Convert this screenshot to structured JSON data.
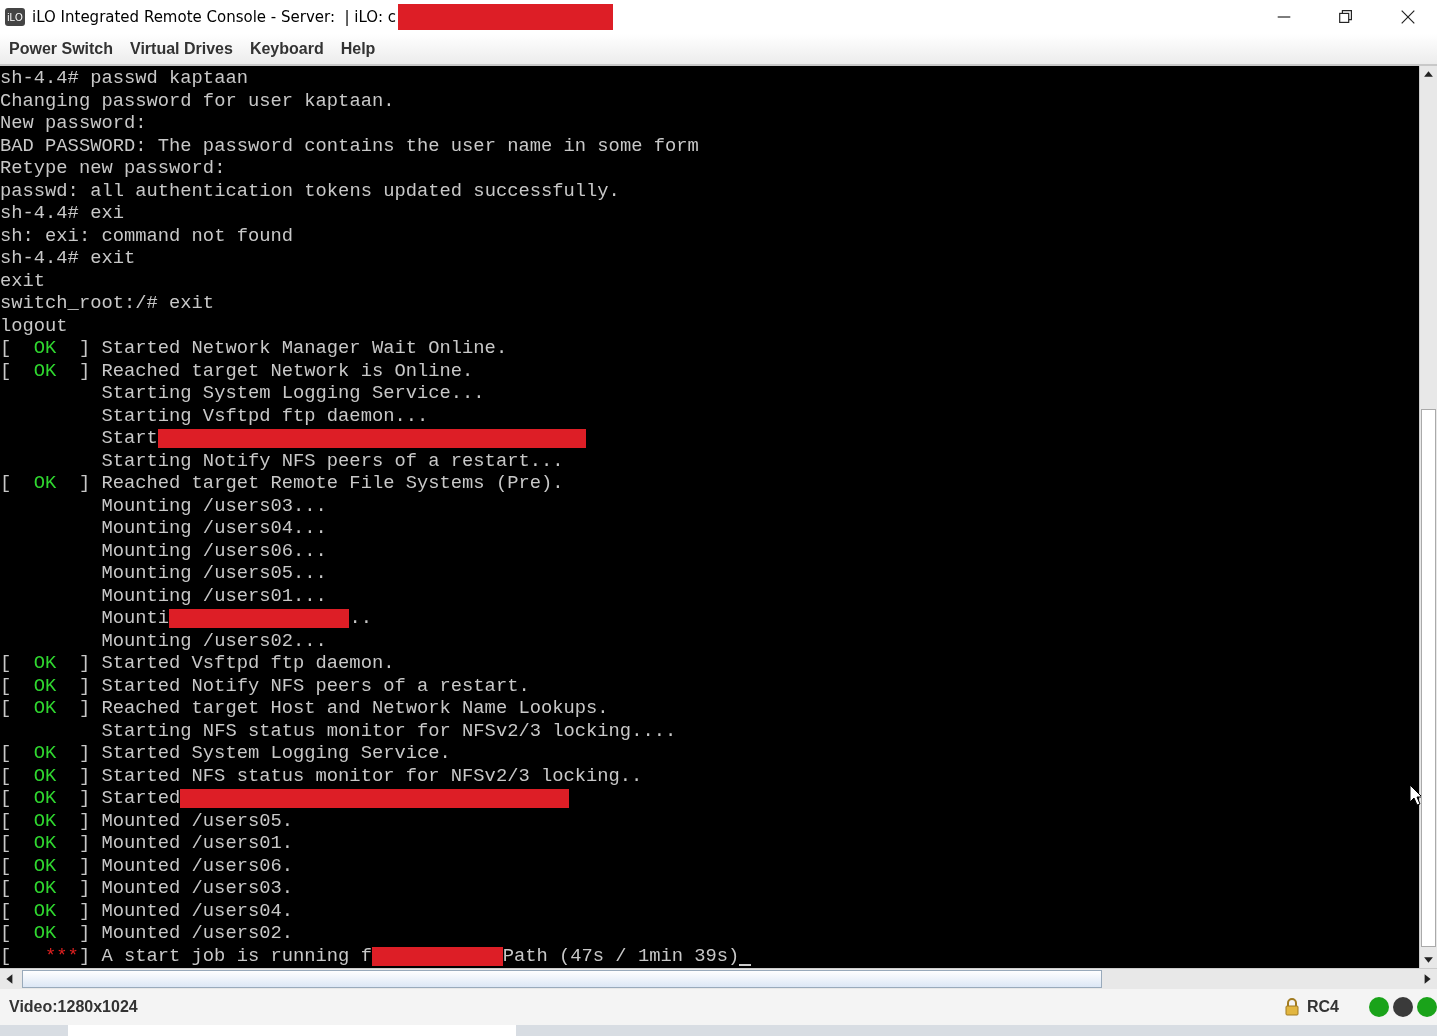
{
  "window": {
    "app_icon": "iLO",
    "title": "iLO Integrated Remote Console - Server:  | iLO: c",
    "title_redacted": true
  },
  "menu": [
    "Power Switch",
    "Virtual Drives",
    "Keyboard",
    "Help"
  ],
  "console": {
    "lines": [
      {
        "kind": "plain",
        "text": "sh-4.4# passwd kaptaan"
      },
      {
        "kind": "plain",
        "text": "Changing password for user kaptaan."
      },
      {
        "kind": "plain",
        "text": "New password:"
      },
      {
        "kind": "plain",
        "text": "BAD PASSWORD: The password contains the user name in some form"
      },
      {
        "kind": "plain",
        "text": "Retype new password:"
      },
      {
        "kind": "plain",
        "text": "passwd: all authentication tokens updated successfully."
      },
      {
        "kind": "plain",
        "text": "sh-4.4# exi"
      },
      {
        "kind": "plain",
        "text": "sh: exi: command not found"
      },
      {
        "kind": "plain",
        "text": "sh-4.4# exit"
      },
      {
        "kind": "plain",
        "text": "exit"
      },
      {
        "kind": "plain",
        "text": "switch_root:/# exit"
      },
      {
        "kind": "plain",
        "text": "logout"
      },
      {
        "kind": "ok",
        "open": "[",
        "status": "OK",
        "close": "]",
        "text": "Started Network Manager Wait Online."
      },
      {
        "kind": "ok",
        "open": "[",
        "status": "OK",
        "close": "]",
        "text": "Reached target Network is Online."
      },
      {
        "kind": "indent",
        "text": "Starting System Logging Service..."
      },
      {
        "kind": "indent",
        "text": "Starting Vsftpd ftp daemon..."
      },
      {
        "kind": "indent",
        "text": "Start",
        "redacted": true
      },
      {
        "kind": "indent",
        "text": "Starting Notify NFS peers of a restart..."
      },
      {
        "kind": "ok",
        "open": "[",
        "status": "OK",
        "close": "]",
        "text": "Reached target Remote File Systems (Pre)."
      },
      {
        "kind": "indent",
        "text": "Mounting /users03..."
      },
      {
        "kind": "indent",
        "text": "Mounting /users04..."
      },
      {
        "kind": "indent",
        "text": "Mounting /users06..."
      },
      {
        "kind": "indent",
        "text": "Mounting /users05..."
      },
      {
        "kind": "indent",
        "text": "Mounting /users01..."
      },
      {
        "kind": "indent",
        "text": "Mounti",
        "redacted": true,
        "after": ".."
      },
      {
        "kind": "indent",
        "text": "Mounting /users02..."
      },
      {
        "kind": "ok",
        "open": "[",
        "status": "OK",
        "close": "]",
        "text": "Started Vsftpd ftp daemon."
      },
      {
        "kind": "ok",
        "open": "[",
        "status": "OK",
        "close": "]",
        "text": "Started Notify NFS peers of a restart."
      },
      {
        "kind": "ok",
        "open": "[",
        "status": "OK",
        "close": "]",
        "text": "Reached target Host and Network Name Lookups."
      },
      {
        "kind": "indent",
        "text": "Starting NFS status monitor for NFSv2/3 locking...."
      },
      {
        "kind": "ok",
        "open": "[",
        "status": "OK",
        "close": "]",
        "text": "Started System Logging Service."
      },
      {
        "kind": "ok",
        "open": "[",
        "status": "OK",
        "close": "]",
        "text": "Started NFS status monitor for NFSv2/3 locking.."
      },
      {
        "kind": "ok",
        "open": "[",
        "status": "OK",
        "close": "]",
        "text": "Started",
        "redacted": true
      },
      {
        "kind": "ok",
        "open": "[",
        "status": "OK",
        "close": "]",
        "text": "Mounted /users05."
      },
      {
        "kind": "ok",
        "open": "[",
        "status": "OK",
        "close": "]",
        "text": "Mounted /users01."
      },
      {
        "kind": "ok",
        "open": "[",
        "status": "OK",
        "close": "]",
        "text": "Mounted /users06."
      },
      {
        "kind": "ok",
        "open": "[",
        "status": "OK",
        "close": "]",
        "text": "Mounted /users03."
      },
      {
        "kind": "ok",
        "open": "[",
        "status": "OK",
        "close": "]",
        "text": "Mounted /users04."
      },
      {
        "kind": "ok",
        "open": "[",
        "status": "OK",
        "close": "]",
        "text": "Mounted /users02."
      },
      {
        "kind": "running",
        "open": "[",
        "status": "***",
        "close": "]",
        "text": "A start job is running f",
        "redacted": true,
        "after": "Path (47s / 1min 39s)"
      }
    ]
  },
  "status_bar": {
    "video": "Video:1280x1024",
    "cipher": "RC4",
    "lights": [
      {
        "color": "#1aa31a"
      },
      {
        "color": "#3a3a3a"
      },
      {
        "color": "#1aa31a"
      }
    ]
  }
}
